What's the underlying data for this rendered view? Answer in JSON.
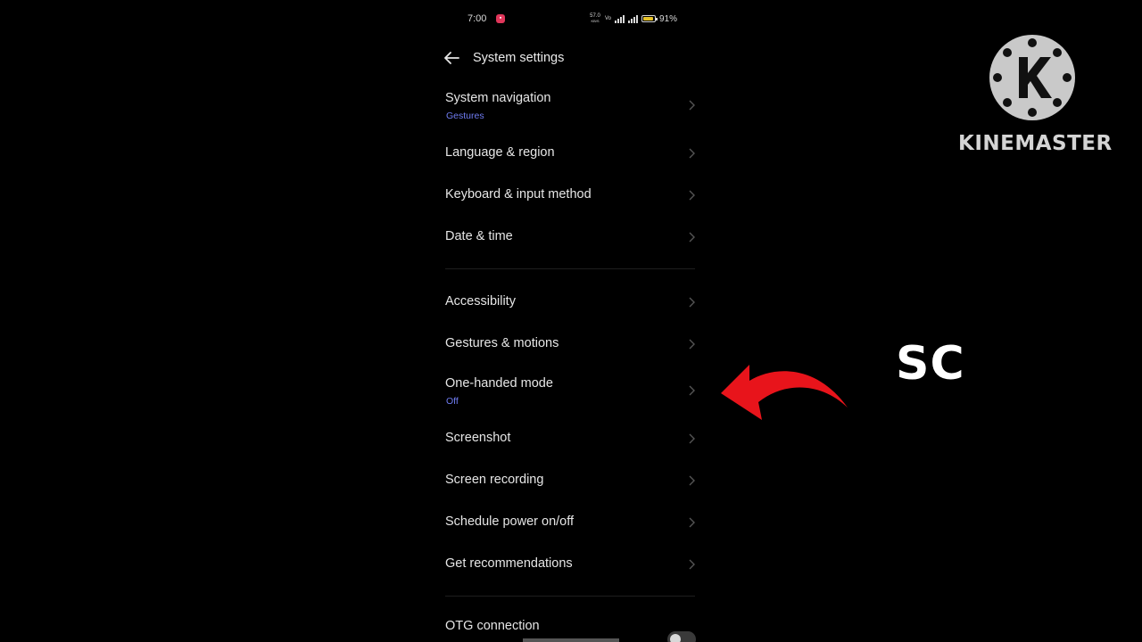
{
  "status_bar": {
    "time": "7:00",
    "net_speed_value": "57.0",
    "net_speed_unit": "KB/S",
    "battery_percent": "91%",
    "battery_level": 0.91
  },
  "header": {
    "title": "System settings",
    "back_icon": "back-arrow-icon"
  },
  "settings": {
    "items": [
      {
        "label": "System navigation",
        "sub": "Gestures"
      },
      {
        "label": "Language & region"
      },
      {
        "label": "Keyboard & input method"
      },
      {
        "label": "Date & time"
      },
      {
        "label": "Accessibility"
      },
      {
        "label": "Gestures & motions"
      },
      {
        "label": "One-handed mode",
        "sub": "Off"
      },
      {
        "label": "Screenshot"
      },
      {
        "label": "Screen recording"
      },
      {
        "label": "Schedule power on/off"
      },
      {
        "label": "Get recommendations"
      },
      {
        "label": "OTG connection"
      }
    ]
  },
  "overlay": {
    "arrow_color": "#e8141b",
    "text": "SC"
  },
  "watermark": {
    "logo_letter": "K",
    "brand": "KINEMASTER"
  },
  "colors": {
    "background": "#000000",
    "accent": "#6f7cf2",
    "text": "#e6e6e6"
  }
}
